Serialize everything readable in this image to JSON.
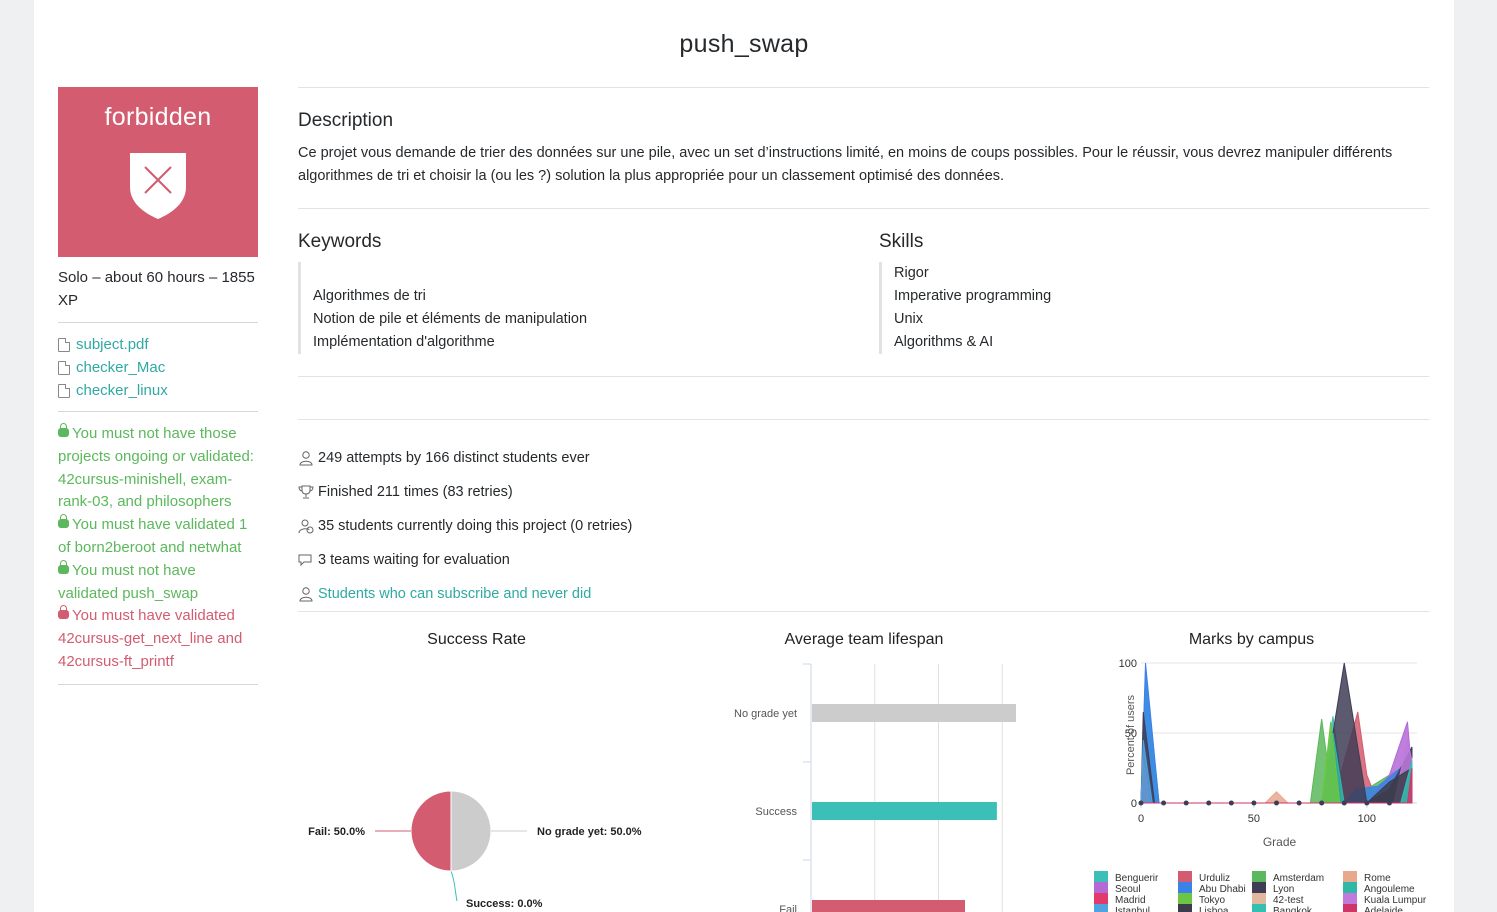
{
  "page": {
    "title": "push_swap"
  },
  "sidebar": {
    "badge_label": "forbidden",
    "meta": "Solo – about 60 hours – 1855 XP",
    "files": [
      {
        "name": "subject.pdf"
      },
      {
        "name": "checker_Mac"
      },
      {
        "name": "checker_linux"
      }
    ],
    "rules": [
      {
        "status": "ok",
        "text": "You must not have those projects ongoing or validated: 42cursus-minishell, exam-rank-03, and philosophers"
      },
      {
        "status": "ok",
        "text": "You must have validated 1 of born2beroot and netwhat"
      },
      {
        "status": "ok",
        "text": "You must not have validated push_swap"
      },
      {
        "status": "ko",
        "text": "You must have validated 42cursus-get_next_line and 42cursus-ft_printf"
      }
    ]
  },
  "description": {
    "heading": "Description",
    "text": "Ce projet vous demande de trier des données sur une pile, avec un set d’instructions limité, en moins de coups possibles. Pour le réussir, vous devrez manipuler différents algorithmes de tri et choisir la (ou les ?) solution la plus appropriée pour un classement optimisé des données."
  },
  "keywords": {
    "heading": "Keywords",
    "items": [
      "",
      "Algorithmes de tri",
      "Notion de pile et éléments de manipulation",
      "Implémentation d'algorithme"
    ]
  },
  "skills": {
    "heading": "Skills",
    "items": [
      "Rigor",
      "Imperative programming",
      "Unix",
      "Algorithms & AI"
    ]
  },
  "stats": {
    "attempts": "249 attempts by 166 distinct students ever",
    "finished": "Finished 211 times (83 retries)",
    "current": "35 students currently doing this project (0 retries)",
    "waiting": "3 teams waiting for evaluation",
    "subscribe_link": "Students who can subscribe and never did"
  },
  "colors": {
    "accent": "#2fa9a3",
    "forbidden": "#d35c70",
    "ok": "#5cb85c"
  },
  "chart_data": [
    {
      "type": "pie",
      "title": "Success Rate",
      "slices": [
        {
          "label": "No grade yet",
          "value": 50.0,
          "text": "No grade yet: 50.0%",
          "color": "#cccccc"
        },
        {
          "label": "Success",
          "value": 0.0,
          "text": "Success: 0.0%",
          "color": "#3bbfb7"
        },
        {
          "label": "Fail",
          "value": 50.0,
          "text": "Fail: 50.0%",
          "color": "#d35c70"
        }
      ]
    },
    {
      "type": "bar",
      "orientation": "horizontal",
      "title": "Average team lifespan",
      "categories": [
        "No grade yet",
        "Success",
        "Fail"
      ],
      "values": [
        3.2,
        2.9,
        2.4
      ],
      "colors": [
        "#cccccc",
        "#3bbfb7",
        "#d35c70"
      ],
      "xlim": [
        0,
        4
      ]
    },
    {
      "type": "area",
      "title": "Marks by campus",
      "xlabel": "Grade",
      "ylabel": "Percent of users",
      "xlim": [
        0,
        120
      ],
      "ylim": [
        0,
        100
      ],
      "xticks": [
        0,
        50,
        100
      ],
      "yticks": [
        0,
        50,
        100
      ],
      "grid": true,
      "series": [
        {
          "name": "Benguerir",
          "color": "#3bbfb7",
          "x": [
            0,
            2,
            8,
            80,
            85,
            90,
            95,
            100,
            115,
            120
          ],
          "y": [
            0,
            95,
            0,
            0,
            62,
            0,
            0,
            0,
            10,
            35
          ]
        },
        {
          "name": "Urduliz",
          "color": "#d35c70",
          "x": [
            0,
            85,
            90,
            96,
            100,
            105,
            120
          ],
          "y": [
            0,
            0,
            30,
            65,
            20,
            0,
            10
          ]
        },
        {
          "name": "Amsterdam",
          "color": "#5cb85c",
          "x": [
            0,
            2,
            6,
            75,
            80,
            85,
            90,
            120
          ],
          "y": [
            0,
            50,
            0,
            0,
            60,
            0,
            0,
            30
          ]
        },
        {
          "name": "Rome",
          "color": "#e8a88e",
          "x": [
            0,
            55,
            60,
            65,
            120
          ],
          "y": [
            0,
            0,
            8,
            0,
            0
          ]
        },
        {
          "name": "Seoul",
          "color": "#b36ad6",
          "x": [
            0,
            2,
            6,
            100,
            110,
            118,
            120
          ],
          "y": [
            0,
            30,
            0,
            0,
            20,
            58,
            20
          ]
        },
        {
          "name": "Abu Dhabi",
          "color": "#3b82e8",
          "x": [
            0,
            2,
            8,
            90,
            95,
            105,
            115,
            120
          ],
          "y": [
            0,
            100,
            0,
            0,
            10,
            12,
            25,
            40
          ]
        },
        {
          "name": "Lyon",
          "color": "#3f3d56",
          "x": [
            0,
            1,
            6,
            80,
            90,
            100,
            110,
            120
          ],
          "y": [
            0,
            65,
            0,
            0,
            100,
            0,
            10,
            40
          ]
        },
        {
          "name": "Angouleme",
          "color": "#2fb8a7",
          "x": [
            0,
            80,
            85,
            90,
            120
          ],
          "y": [
            0,
            0,
            50,
            0,
            0
          ]
        },
        {
          "name": "Madrid",
          "color": "#e23b6b",
          "x": [
            0,
            1,
            4,
            120
          ],
          "y": [
            0,
            30,
            0,
            0
          ]
        },
        {
          "name": "Tokyo",
          "color": "#6cc644",
          "x": [
            0,
            80,
            84,
            88,
            120
          ],
          "y": [
            0,
            0,
            58,
            0,
            0
          ]
        },
        {
          "name": "42-test",
          "color": "#e0b8a0",
          "x": [
            0,
            118,
            120
          ],
          "y": [
            0,
            0,
            32
          ]
        },
        {
          "name": "Kuala Lumpur",
          "color": "#c07adb",
          "x": [
            0,
            112,
            118,
            120
          ],
          "y": [
            0,
            0,
            45,
            30
          ]
        },
        {
          "name": "Istanbul",
          "color": "#4fa3e0",
          "x": [
            0,
            1,
            5,
            120
          ],
          "y": [
            0,
            45,
            0,
            0
          ]
        },
        {
          "name": "Lisboa",
          "color": "#3c3c4a",
          "x": [
            0,
            100,
            110,
            120
          ],
          "y": [
            0,
            0,
            15,
            25
          ]
        },
        {
          "name": "Bangkok",
          "color": "#35bfb1",
          "x": [
            0,
            115,
            120
          ],
          "y": [
            0,
            0,
            30
          ]
        },
        {
          "name": "Adelaide",
          "color": "#d0356a",
          "x": [
            0,
            118,
            120
          ],
          "y": [
            0,
            0,
            25
          ]
        }
      ]
    }
  ]
}
